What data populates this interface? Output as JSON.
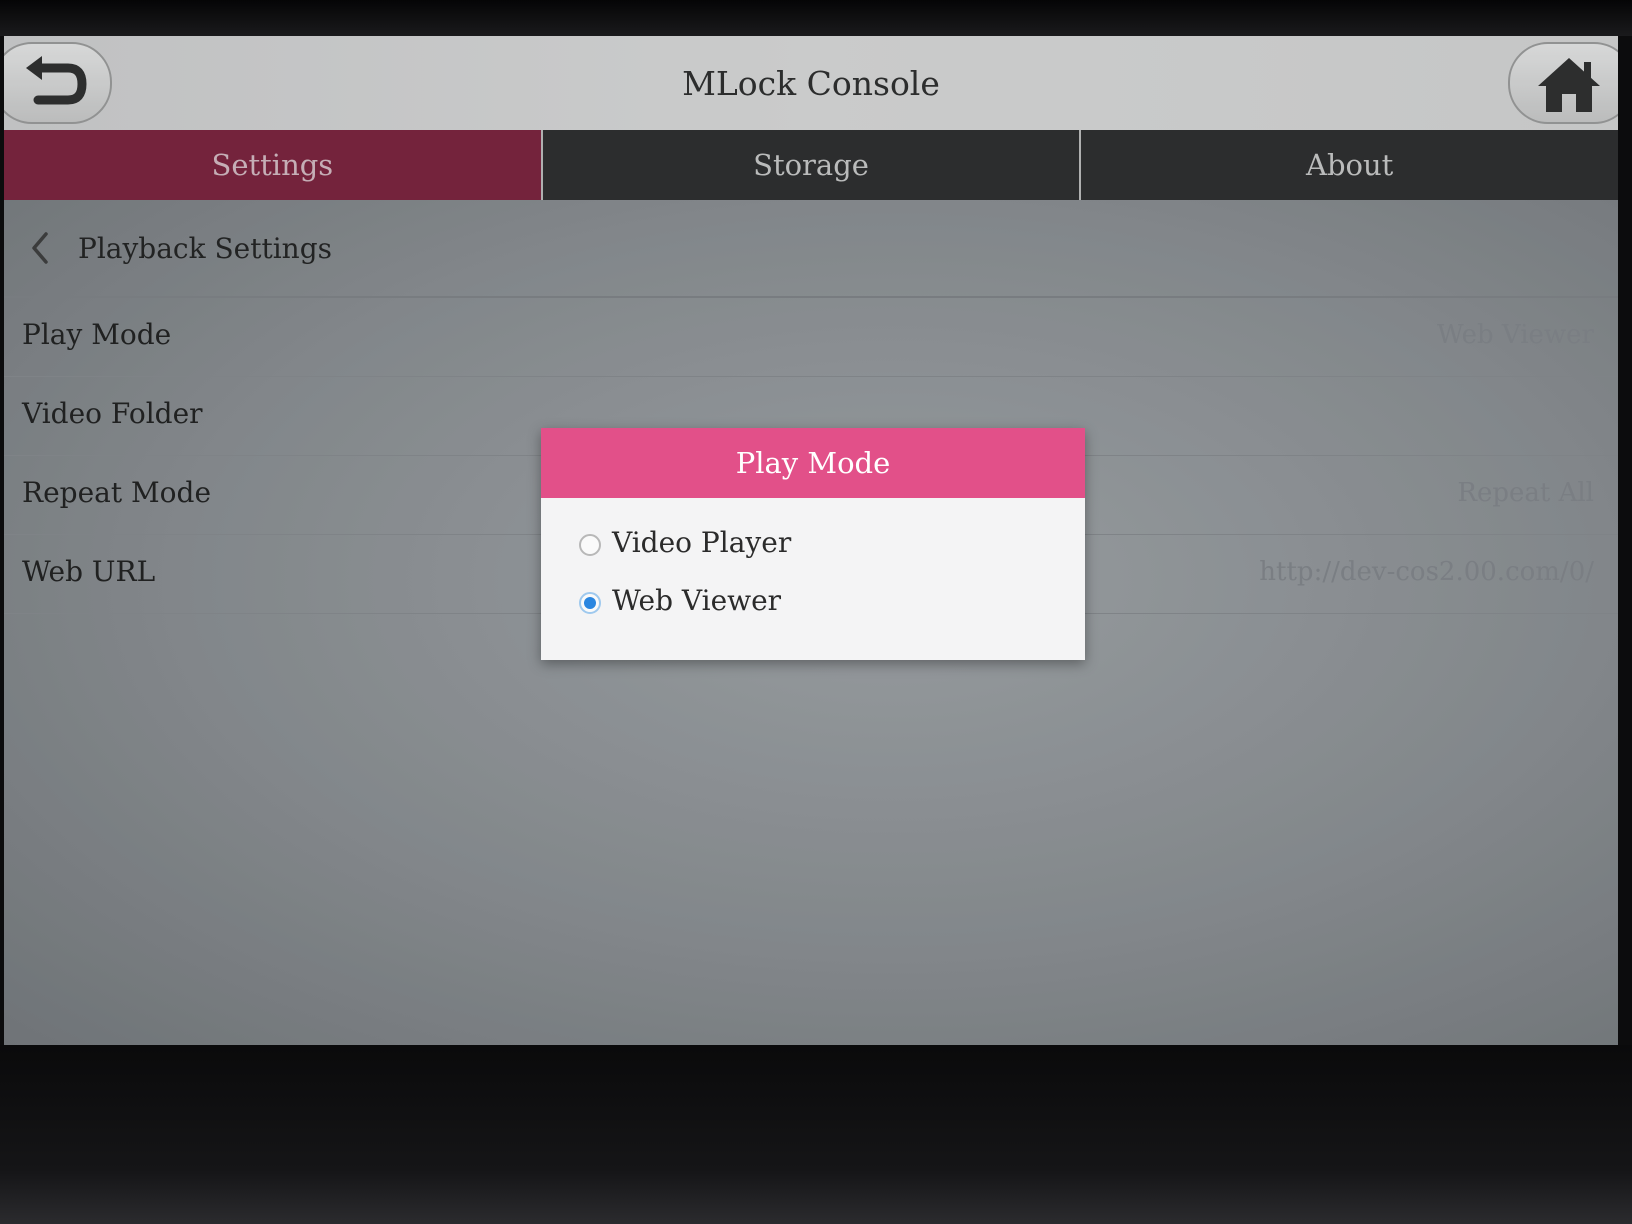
{
  "app": {
    "title": "MLock Console"
  },
  "tabs": [
    {
      "label": "Settings",
      "active": true
    },
    {
      "label": "Storage",
      "active": false
    },
    {
      "label": "About",
      "active": false
    }
  ],
  "section": {
    "title": "Playback Settings"
  },
  "settings": [
    {
      "label": "Play Mode",
      "value": "Web Viewer"
    },
    {
      "label": "Video Folder",
      "value": ""
    },
    {
      "label": "Repeat Mode",
      "value": "Repeat All"
    },
    {
      "label": "Web URL",
      "value": "http://dev-cos2.00.com/0/"
    }
  ],
  "dialog": {
    "title": "Play Mode",
    "options": [
      {
        "label": "Video Player",
        "checked": false
      },
      {
        "label": "Web Viewer",
        "checked": true
      }
    ]
  },
  "colors": {
    "accent_tab": "#7a1f3a",
    "dialog_header": "#e25089",
    "radio_selected": "#2a86e0"
  },
  "icons": [
    "back-arrow-icon",
    "home-icon",
    "chevron-left-icon"
  ]
}
